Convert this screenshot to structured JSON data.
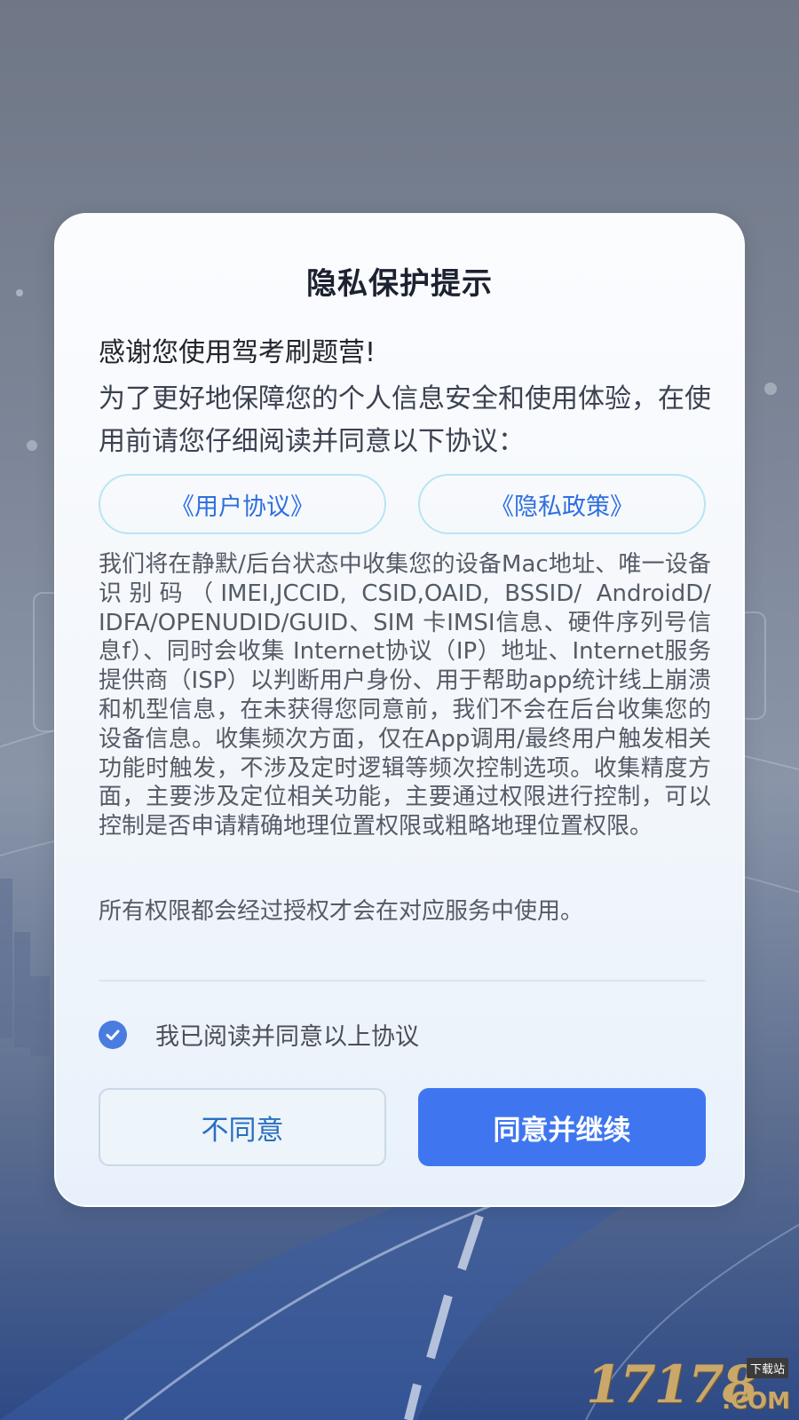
{
  "dialog": {
    "title": "隐私保护提示",
    "greeting": "感谢您使用驾考刷题营!",
    "intro": "为了更好地保障您的个人信息安全和使用体验，在使用前请您仔细阅读并同意以下协议：",
    "links": {
      "user_agreement": "《用户协议》",
      "privacy_policy": "《隐私政策》"
    },
    "body": "我们将在静默/后台状态中收集您的设备Mac地址、唯一设备识别码（IMEI,JCCID, CSID,OAID, BSSID/ AndroidD/ IDFA/OPENUDID/GUID、SIM 卡IMSI信息、硬件序列号信息f）、同时会收集 Internet协议（IP）地址、Internet服务提供商（ISP）以判断用户身份、用于帮助app统计线上崩溃和机型信息，在未获得您同意前，我们不会在后台收集您的设备信息。收集频次方面，仅在App调用/最终用户触发相关功能时触发，不涉及定时逻辑等频次控制选项。收集精度方面，主要涉及定位相关功能，主要通过权限进行控制，可以控制是否申请精确地理位置权限或粗略地理位置权限。",
    "note": "所有权限都会经过授权才会在对应服务中使用。",
    "agree_checkbox": {
      "label": "我已阅读并同意以上协议",
      "checked": true,
      "icon": "check-icon"
    },
    "buttons": {
      "disagree": "不同意",
      "agree": "同意并继续"
    }
  },
  "watermark": {
    "number": "17178",
    "domain": ".COM",
    "tag": "下载站"
  },
  "colors": {
    "accent": "#3f76ef",
    "link": "#2f6fe0",
    "link_border": "#b9e4f4"
  }
}
